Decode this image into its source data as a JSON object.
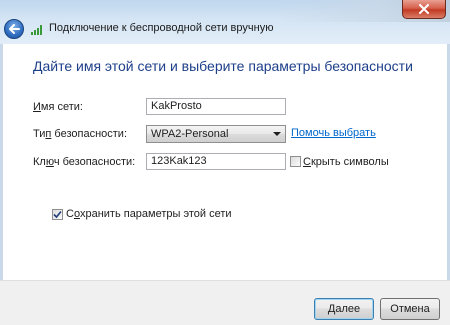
{
  "window": {
    "title": "Подключение к беспроводной сети вручную",
    "close_glyph": "✕"
  },
  "heading": "Дайте имя этой сети и выберите параметры безопасности",
  "form": {
    "network_name": {
      "label_pre": "",
      "label_ul": "И",
      "label_post": "мя сети:",
      "value": "KakProsto"
    },
    "security_type": {
      "label_pre": "Ти",
      "label_ul": "п",
      "label_post": " безопасности:",
      "value": "WPA2-Personal"
    },
    "help_link": "Помочь выбрать",
    "security_key": {
      "label_pre": "Кл",
      "label_ul": "ю",
      "label_post": "ч безопасности:",
      "value": "123Kak123"
    },
    "hide_chars": {
      "label_pre": "",
      "label_ul": "С",
      "label_post": "крыть символы",
      "checked": false
    },
    "save_settings": {
      "label_pre": "С",
      "label_ul": "о",
      "label_post": "хранить параметры этой сети",
      "checked": true
    }
  },
  "buttons": {
    "next": {
      "label_pre": "",
      "label_ul": "Д",
      "label_post": "алее"
    },
    "cancel": "Отмена"
  },
  "colors": {
    "heading": "#1e3f8a",
    "link": "#0066cc",
    "close": "#c23a22"
  }
}
